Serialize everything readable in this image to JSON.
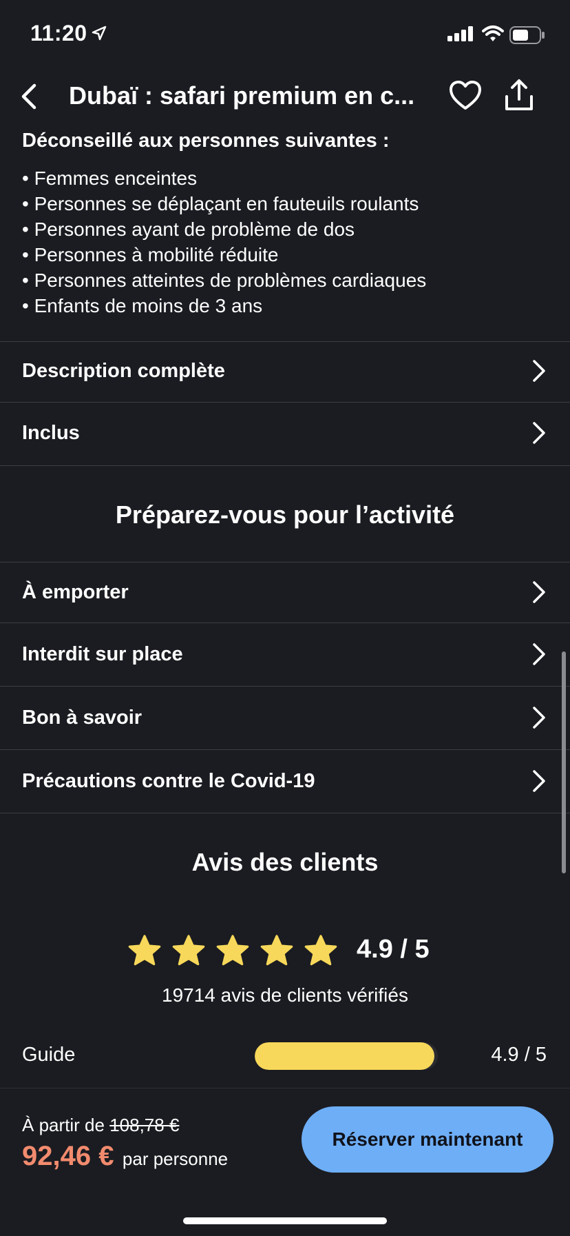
{
  "status": {
    "time": "11:20"
  },
  "nav": {
    "title": "Dubaï : safari premium en c..."
  },
  "warning": {
    "heading": "Déconseillé aux personnes suivantes :",
    "items": [
      "Femmes enceintes",
      "Personnes se déplaçant en fauteuils roulants",
      "Personnes ayant de problème de dos",
      "Personnes à mobilité réduite",
      "Personnes atteintes de problèmes cardiaques",
      "Enfants de moins de 3 ans"
    ]
  },
  "info_rows": {
    "description": "Description complète",
    "included": "Inclus"
  },
  "prepare": {
    "title": "Préparez-vous pour l’activité",
    "rows": {
      "to_bring": "À emporter",
      "forbidden": "Interdit sur place",
      "good_to_know": "Bon à savoir",
      "covid": "Précautions contre le Covid-19"
    }
  },
  "reviews": {
    "title": "Avis des clients",
    "score": "4.9 / 5",
    "stars_filled": 5,
    "count_text": "19714 avis de clients vérifiés",
    "categories": {
      "guide": {
        "label": "Guide",
        "score": "4.9 / 5",
        "value": 4.9,
        "max": 5
      }
    }
  },
  "booking": {
    "from_label": "À partir de",
    "old_price": "108,78 €",
    "price": "92,46 €",
    "per_person": "par personne",
    "button_label": "Réserver maintenant"
  },
  "colors": {
    "background": "#1b1c21",
    "star": "#f7d85a",
    "price": "#f28b6e",
    "button": "#6eaef7"
  }
}
